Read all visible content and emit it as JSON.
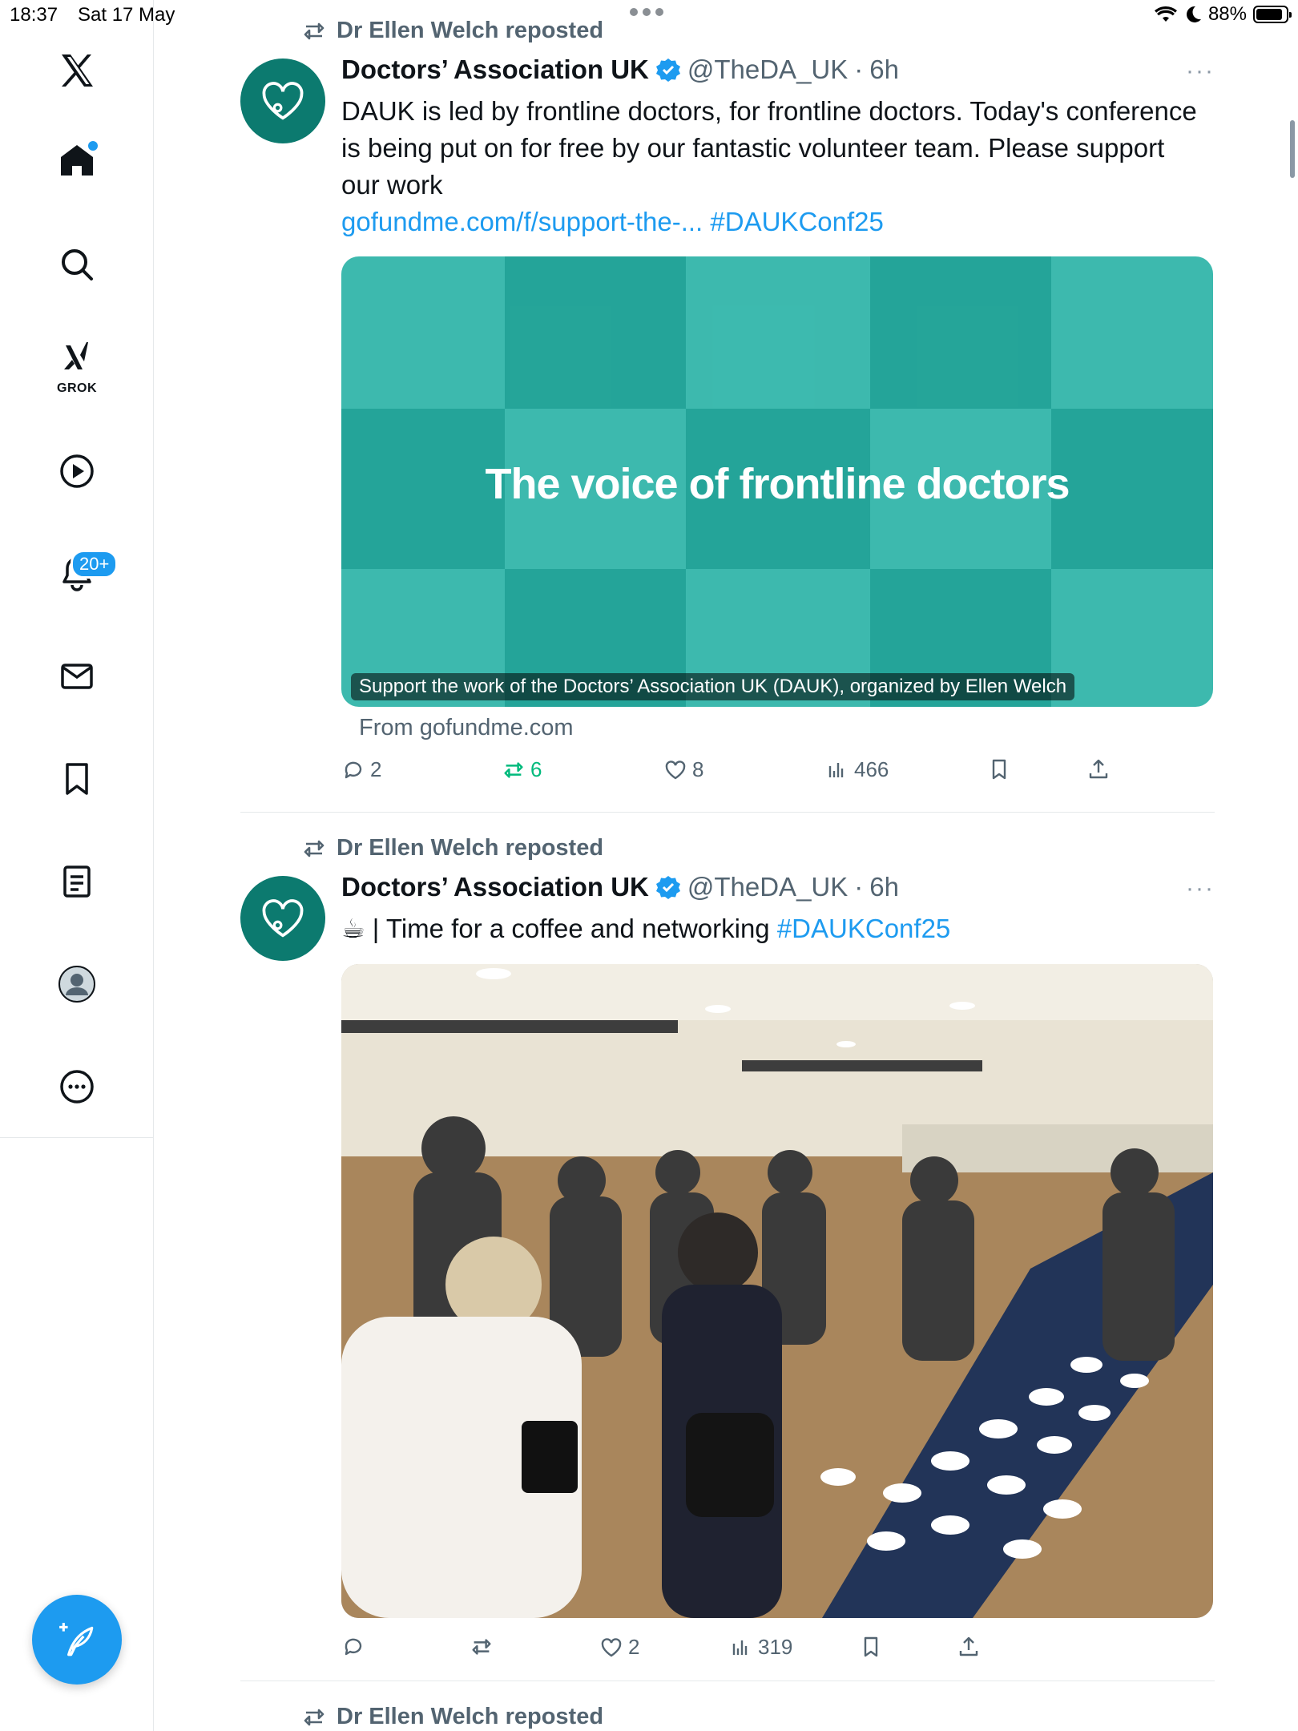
{
  "status_bar": {
    "time": "18:37",
    "date": "Sat 17 May",
    "battery": "88%",
    "battery_level": 0.88
  },
  "sidebar": {
    "grok_label": "GROK",
    "notifications_badge": "20+",
    "items": [
      "x-logo",
      "home",
      "search",
      "grok",
      "video",
      "notifications",
      "messages",
      "bookmarks",
      "lists",
      "profile",
      "more"
    ]
  },
  "colors": {
    "accent": "#1d9bf0",
    "avatar_bg": "#0c7a6f",
    "repost_green": "#00ba7c",
    "card_teal": "#2ab3a7"
  },
  "posts": [
    {
      "repost_label": "Dr Ellen Welch reposted",
      "author": "Doctors’ Association UK",
      "handle": "@TheDA_UK",
      "separator": "·",
      "time": "6h",
      "more": "···",
      "text": "DAUK is led by frontline doctors, for frontline doctors. Today's conference is being put on for free by our fantastic volunteer team. Please support our work",
      "link": "gofundme.com/f/support-the-...",
      "hashtag": "#DAUKConf25",
      "card": {
        "headline": "The voice of frontline doctors",
        "caption": "Support the work of the Doctors’ Association UK (DAUK), organized by Ellen Welch",
        "from": "From gofundme.com"
      },
      "stats": {
        "replies": "2",
        "reposts": "6",
        "likes": "8",
        "views": "466"
      }
    },
    {
      "repost_label": "Dr Ellen Welch reposted",
      "author": "Doctors’ Association UK",
      "handle": "@TheDA_UK",
      "separator": "·",
      "time": "6h",
      "more": "···",
      "text": "☕ | Time for a coffee and networking",
      "hashtag": "#DAUKConf25",
      "stats": {
        "replies": "",
        "reposts": "",
        "likes": "2",
        "views": "319"
      }
    },
    {
      "repost_label": "Dr Ellen Welch reposted"
    }
  ]
}
